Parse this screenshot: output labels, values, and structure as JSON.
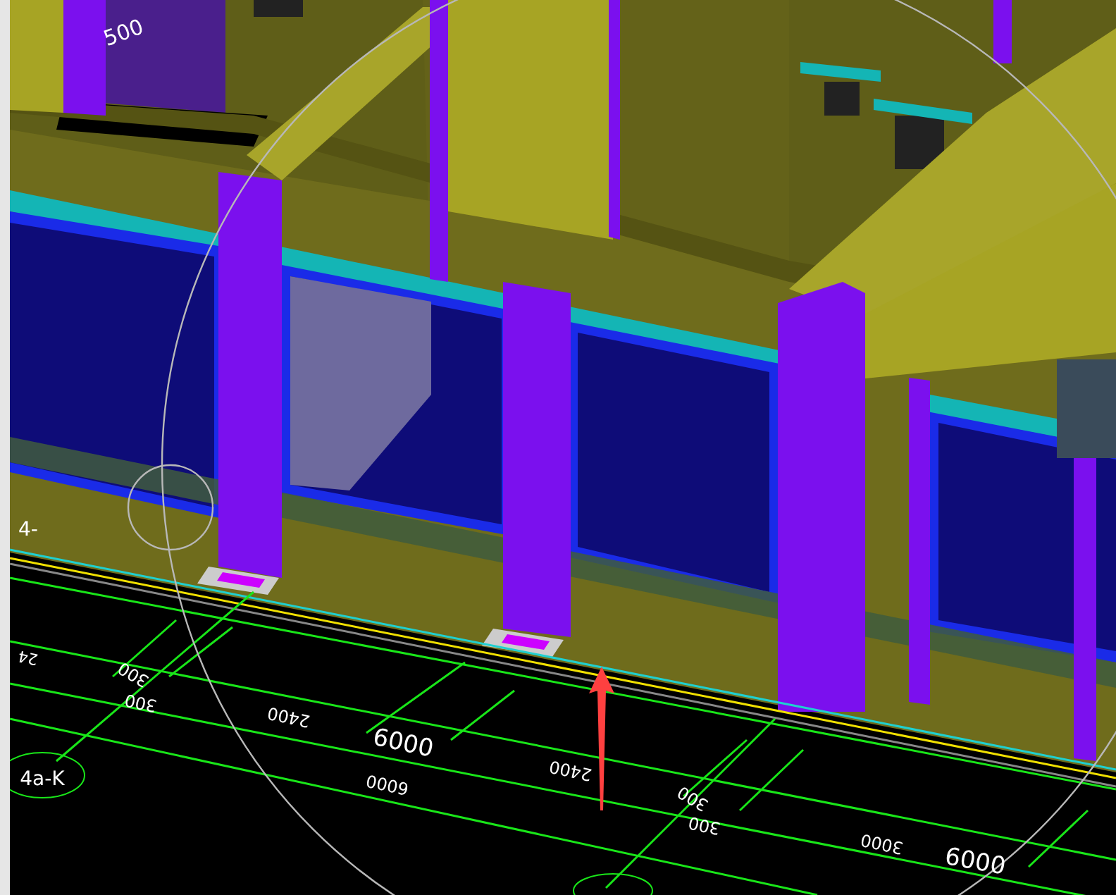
{
  "viewport": {
    "labels": [
      {
        "text": "500",
        "inverted": false
      },
      {
        "text": "6000",
        "inverted": false
      },
      {
        "text": "2400",
        "inverted": true
      },
      {
        "text": "300",
        "inverted": true
      },
      {
        "text": "300",
        "inverted": true
      },
      {
        "text": "2400",
        "inverted": true
      },
      {
        "text": "6000",
        "inverted": true
      },
      {
        "text": "300",
        "inverted": true
      },
      {
        "text": "300",
        "inverted": true
      },
      {
        "text": "3000",
        "inverted": true
      },
      {
        "text": "6000",
        "inverted": false
      },
      {
        "text": "24",
        "inverted": true
      },
      {
        "text": "4-",
        "inverted": false
      },
      {
        "text": "4a-K",
        "inverted": false
      }
    ]
  }
}
